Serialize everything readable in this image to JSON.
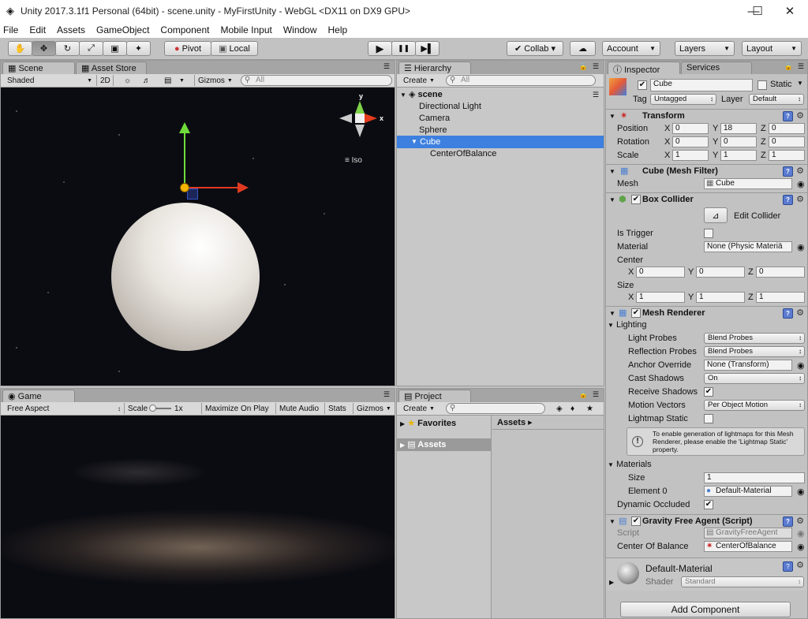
{
  "titlebar": {
    "title": "Unity 2017.3.1f1 Personal (64bit) - scene.unity - MyFirstUnity - WebGL <DX11 on DX9 GPU>",
    "minimize": "—",
    "maximize": "☐",
    "close": "✕"
  },
  "menu": [
    "File",
    "Edit",
    "Assets",
    "GameObject",
    "Component",
    "Mobile Input",
    "Window",
    "Help"
  ],
  "toolbar": {
    "tools": [
      "✋",
      "✥",
      "↻",
      "⤢",
      "▣",
      "✦"
    ],
    "pivot": "Pivot",
    "local": "Local",
    "play": "▶",
    "pause": "❚❚",
    "step": "▶▌",
    "collab": "Collab ▾",
    "cloud": "☁",
    "account": "Account",
    "layers": "Layers",
    "layout": "Layout"
  },
  "scene": {
    "tab": "Scene",
    "tab2": "Asset Store",
    "shading": "Shaded",
    "mode2d": "2D",
    "gizmos": "Gizmos",
    "search_placeholder": "All",
    "iso": "Iso",
    "axis_y": "y",
    "axis_x": "x"
  },
  "game": {
    "tab": "Game",
    "aspect": "Free Aspect",
    "scale_label": "Scale",
    "scale_value": "1x",
    "maximize": "Maximize On Play",
    "mute": "Mute Audio",
    "stats": "Stats",
    "gizmos": "Gizmos"
  },
  "hierarchy": {
    "tab": "Hierarchy",
    "create": "Create",
    "search_placeholder": "All",
    "scene_name": "scene",
    "items": [
      {
        "label": "Directional Light",
        "indent": 1,
        "selected": false
      },
      {
        "label": "Camera",
        "indent": 1,
        "selected": false
      },
      {
        "label": "Sphere",
        "indent": 1,
        "selected": false
      },
      {
        "label": "Cube",
        "indent": 1,
        "selected": true
      },
      {
        "label": "CenterOfBalance",
        "indent": 2,
        "selected": false
      }
    ]
  },
  "project": {
    "tab": "Project",
    "create": "Create",
    "favorites": "Favorites",
    "assets": "Assets",
    "breadcrumb": "Assets ▸"
  },
  "inspector": {
    "tab": "Inspector",
    "tab2": "Services",
    "object_name": "Cube",
    "static_label": "Static",
    "tag_label": "Tag",
    "tag_value": "Untagged",
    "layer_label": "Layer",
    "layer_value": "Default",
    "transform": {
      "title": "Transform",
      "position": {
        "label": "Position",
        "x": "0",
        "y": "18",
        "z": "0"
      },
      "rotation": {
        "label": "Rotation",
        "x": "0",
        "y": "0",
        "z": "0"
      },
      "scale": {
        "label": "Scale",
        "x": "1",
        "y": "1",
        "z": "1"
      }
    },
    "mesh_filter": {
      "title": "Cube (Mesh Filter)",
      "mesh_label": "Mesh",
      "mesh_value": "Cube"
    },
    "box_collider": {
      "title": "Box Collider",
      "edit": "Edit Collider",
      "is_trigger": "Is Trigger",
      "material_label": "Material",
      "material_value": "None (Physic Materiä",
      "center_label": "Center",
      "cx": "0",
      "cy": "0",
      "cz": "0",
      "size_label": "Size",
      "sx": "1",
      "sy": "1",
      "sz": "1"
    },
    "mesh_renderer": {
      "title": "Mesh Renderer",
      "lighting": "Lighting",
      "light_probes_label": "Light Probes",
      "light_probes_value": "Blend Probes",
      "reflection_probes_label": "Reflection Probes",
      "reflection_probes_value": "Blend Probes",
      "anchor_label": "Anchor Override",
      "anchor_value": "None (Transform)",
      "cast_label": "Cast Shadows",
      "cast_value": "On",
      "receive_label": "Receive Shadows",
      "motion_label": "Motion Vectors",
      "motion_value": "Per Object Motion",
      "lightmap_label": "Lightmap Static",
      "info": "To enable generation of lightmaps for this Mesh Renderer, please enable the 'Lightmap Static' property.",
      "materials": "Materials",
      "size_label": "Size",
      "size_value": "1",
      "element_label": "Element 0",
      "element_value": "Default-Material",
      "dynamic_label": "Dynamic Occluded"
    },
    "script_comp": {
      "title": "Gravity Free Agent (Script)",
      "script_label": "Script",
      "script_value": "GravityFreeAgent",
      "cob_label": "Center Of Balance",
      "cob_value": "CenterOfBalance"
    },
    "material": {
      "name": "Default-Material",
      "shader_label": "Shader",
      "shader_value": "Standard"
    },
    "add_component": "Add Component"
  }
}
